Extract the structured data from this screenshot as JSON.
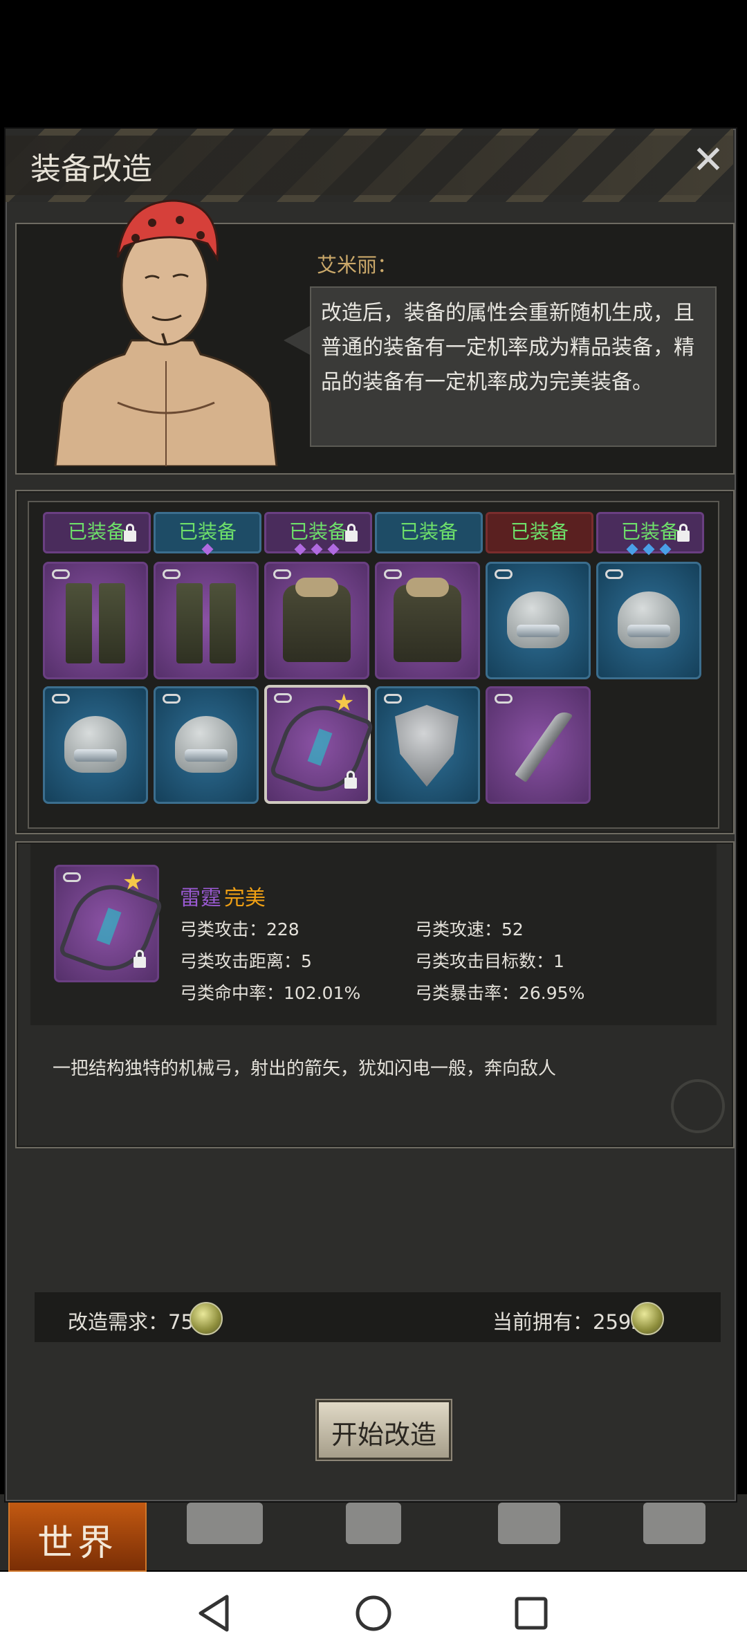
{
  "dialog": {
    "title": "装备改造",
    "close_icon": "close-icon"
  },
  "npc": {
    "speaker": "艾米丽：",
    "message": "改造后，装备的属性会重新随机生成，且普通的装备有一定机率成为精品装备，精品的装备有一定机率成为完美装备。"
  },
  "inventory": {
    "equipped_rows": [
      {
        "label": "已装备",
        "rarity": "purple",
        "locked": true,
        "gems": []
      },
      {
        "label": "已装备",
        "rarity": "blue",
        "locked": false,
        "gems": [
          "purple"
        ]
      },
      {
        "label": "已装备",
        "rarity": "purple",
        "locked": true,
        "gems": [
          "purple",
          "purple",
          "purple"
        ]
      },
      {
        "label": "已装备",
        "rarity": "blue",
        "locked": false,
        "gems": []
      },
      {
        "label": "已装备",
        "rarity": "red",
        "locked": false,
        "gems": []
      },
      {
        "label": "已装备",
        "rarity": "purple",
        "locked": true,
        "gems": [
          "blue",
          "blue",
          "blue"
        ]
      }
    ],
    "items": [
      {
        "name": "pants-icon",
        "rarity": "purple"
      },
      {
        "name": "pants-icon",
        "rarity": "purple"
      },
      {
        "name": "jacket-icon",
        "rarity": "purple"
      },
      {
        "name": "jacket-icon",
        "rarity": "purple"
      },
      {
        "name": "helmet-icon",
        "rarity": "blue"
      },
      {
        "name": "helmet-icon",
        "rarity": "blue"
      },
      {
        "name": "helmet-icon",
        "rarity": "blue"
      },
      {
        "name": "helmet-icon",
        "rarity": "blue"
      },
      {
        "name": "crossbow-icon",
        "rarity": "purple",
        "selected": true,
        "starred": true,
        "locked": true
      },
      {
        "name": "shield-icon",
        "rarity": "blue"
      },
      {
        "name": "knife-icon",
        "rarity": "purple"
      }
    ]
  },
  "selected_item": {
    "name": "雷霆",
    "quality": "完美",
    "stats": {
      "attack": "弓类攻击：228",
      "speed": "弓类攻速：52",
      "range": "弓类攻击距离：5",
      "targets": "弓类攻击目标数：1",
      "accuracy": "弓类命中率：102.01%",
      "crit": "弓类暴击率：26.95%"
    },
    "description": "一把结构独特的机械弓，射出的箭矢，犹如闪电一般，奔向敌人"
  },
  "cost": {
    "required_label": "改造需求：75",
    "owned_label": "当前拥有：2592"
  },
  "actions": {
    "start_label": "开始改造"
  },
  "bottom_nav": {
    "world_label": "世界"
  },
  "colors": {
    "purple_quality": "#9a5ad2",
    "orange_quality": "#f0a014",
    "equipped_green": "#6ee06a"
  }
}
